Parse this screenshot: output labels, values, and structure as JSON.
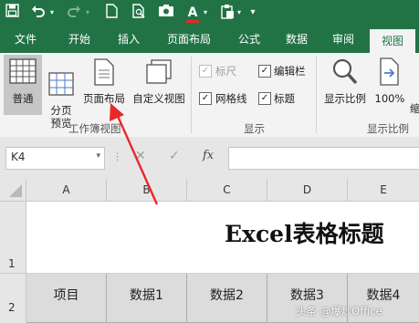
{
  "quick_access": {
    "save_icon": "save-icon",
    "undo_icon": "undo-icon",
    "redo_icon": "redo-icon",
    "new_icon": "new-document-icon",
    "preview_icon": "print-preview-icon",
    "camera_icon": "camera-icon",
    "font_color_letter": "A",
    "paste_icon": "paste-icon"
  },
  "tabs": [
    "文件",
    "开始",
    "插入",
    "页面布局",
    "公式",
    "数据",
    "审阅",
    "视图"
  ],
  "active_tab": "视图",
  "ribbon": {
    "workbook_views": {
      "buttons": [
        "普通",
        "分页\n预览",
        "页面布局",
        "自定义视图"
      ],
      "group_label": "工作簿视图"
    },
    "show": {
      "items": [
        {
          "label": "标尺",
          "checked": true,
          "disabled": true
        },
        {
          "label": "编辑栏",
          "checked": true,
          "disabled": false
        },
        {
          "label": "网格线",
          "checked": true,
          "disabled": false
        },
        {
          "label": "标题",
          "checked": true,
          "disabled": false
        }
      ],
      "group_label": "显示"
    },
    "zoom": {
      "buttons": [
        "显示比例",
        "100%",
        "缩\n选"
      ],
      "group_label": "显示比例"
    }
  },
  "formula_bar": {
    "name_box": "K4",
    "fx_label": "fx",
    "content": ""
  },
  "sheet": {
    "columns": [
      "A",
      "B",
      "C",
      "D",
      "E"
    ],
    "rows": [
      "1",
      "2"
    ],
    "title": "Excel表格标题",
    "headers": [
      "项目",
      "数据1",
      "数据2",
      "数据3",
      "数据4"
    ]
  },
  "watermark": "头条 @爆炒Office",
  "colors": {
    "accent": "#217346",
    "arrow": "#e8282b"
  }
}
